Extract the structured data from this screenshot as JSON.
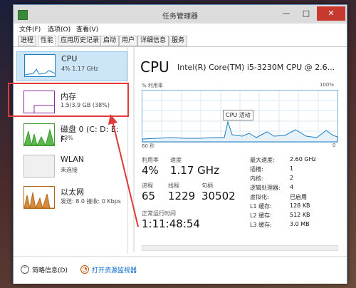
{
  "window": {
    "title": "任务管理器",
    "buttons": {
      "minimize": "—",
      "maximize": "□",
      "close": "✕"
    }
  },
  "menu": [
    "文件(F)",
    "选项(O)",
    "查看(V)"
  ],
  "tabs": [
    "进程",
    "性能",
    "应用历史记录",
    "启动",
    "用户",
    "详细信息",
    "服务"
  ],
  "active_tab": "性能",
  "sidebar": {
    "items": [
      {
        "name": "CPU",
        "sub": "4% 1.17 GHz",
        "color": "#1a7ec0"
      },
      {
        "name": "内存",
        "sub": "1.5/3.9 GB (38%)",
        "color": "#8b2aa3"
      },
      {
        "name": "磁盘 0 (C: D: E: F:",
        "sub": "13%",
        "color": "#3c9a2c"
      },
      {
        "name": "WLAN",
        "sub": "未连接",
        "color": "#999999"
      },
      {
        "name": "以太网",
        "sub": "发送: 8.0  接收: 0 Kbps",
        "color": "#b06a1c"
      }
    ]
  },
  "main": {
    "title": "CPU",
    "model": "Intel(R) Core(TM) i5-3230M CPU @ 2.6...",
    "graph_label_left": "% 利用率",
    "graph_label_right": "100%",
    "graph_axis_left": "60 秒",
    "graph_axis_right": "0",
    "graph_tooltip": "CPU 活动",
    "stats": {
      "utilization_label": "利用率",
      "utilization": "4%",
      "speed_label": "速度",
      "speed": "1.17 GHz",
      "processes_label": "进程",
      "processes": "65",
      "threads_label": "线程",
      "threads": "1229",
      "handles_label": "句柄",
      "handles": "30502",
      "uptime_label": "正常运行时间",
      "uptime": "1:11:48:54"
    },
    "details": [
      {
        "k": "最大速度:",
        "v": "2.60 GHz"
      },
      {
        "k": "插槽:",
        "v": "1"
      },
      {
        "k": "内核:",
        "v": "2"
      },
      {
        "k": "逻辑处理器:",
        "v": "4"
      },
      {
        "k": "虚拟化:",
        "v": "已启用"
      },
      {
        "k": "L1 缓存:",
        "v": "128 KB"
      },
      {
        "k": "L2 缓存:",
        "v": "512 KB"
      },
      {
        "k": "L3 缓存:",
        "v": "3.0 MB"
      }
    ]
  },
  "footer": {
    "summary": "简略信息(D)",
    "monitor": "打开资源监视器"
  },
  "accent": "#1a7ec0",
  "highlight": "#e03a3a"
}
